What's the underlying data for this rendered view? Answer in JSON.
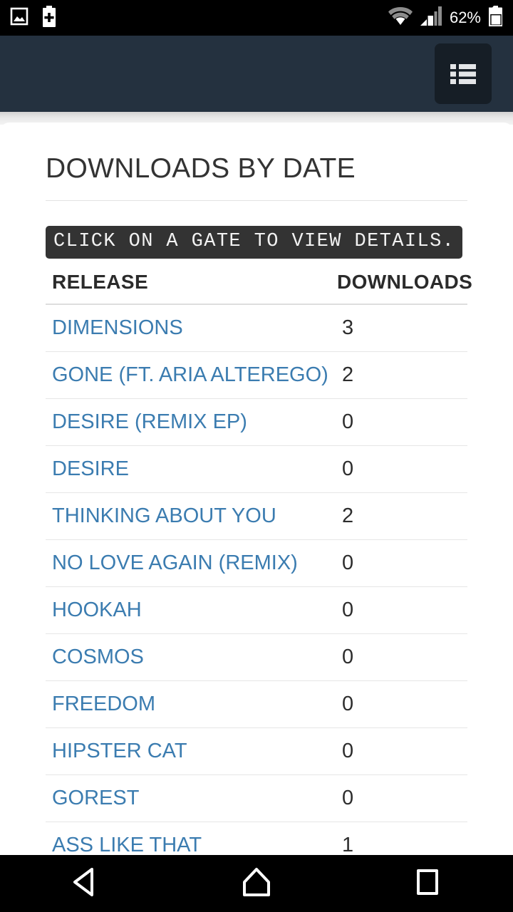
{
  "status_bar": {
    "left_icons": [
      "screenshot-image-icon",
      "battery-saver-icon"
    ],
    "right_icons": [
      "wifi-icon",
      "cellular-signal-icon",
      "battery-icon"
    ],
    "battery_percent": "62%"
  },
  "app_bar": {
    "menu_button_icon": "list-view-icon",
    "background_color": "#24313f",
    "button_color": "#161e26"
  },
  "content": {
    "page_title": "DOWNLOADS BY DATE",
    "notice": "CLICK ON A GATE TO VIEW DETAILS.",
    "table": {
      "columns": [
        "RELEASE",
        "DOWNLOADS"
      ],
      "link_color": "#3b7cb0",
      "rows": [
        {
          "release": "DIMENSIONS",
          "downloads": "3"
        },
        {
          "release": "GONE (FT. ARIA ALTEREGO)",
          "downloads": "2"
        },
        {
          "release": "DESIRE (REMIX EP)",
          "downloads": "0"
        },
        {
          "release": "DESIRE",
          "downloads": "0"
        },
        {
          "release": "THINKING ABOUT YOU",
          "downloads": "2"
        },
        {
          "release": "NO LOVE AGAIN (REMIX)",
          "downloads": "0"
        },
        {
          "release": "HOOKAH",
          "downloads": "0"
        },
        {
          "release": "COSMOS",
          "downloads": "0"
        },
        {
          "release": "FREEDOM",
          "downloads": "0"
        },
        {
          "release": "HIPSTER CAT",
          "downloads": "0"
        },
        {
          "release": "GOREST",
          "downloads": "0"
        },
        {
          "release": "ASS LIKE THAT",
          "downloads": "1"
        }
      ]
    }
  },
  "nav_bar": {
    "buttons": [
      "back-button",
      "home-button",
      "recents-button"
    ]
  }
}
